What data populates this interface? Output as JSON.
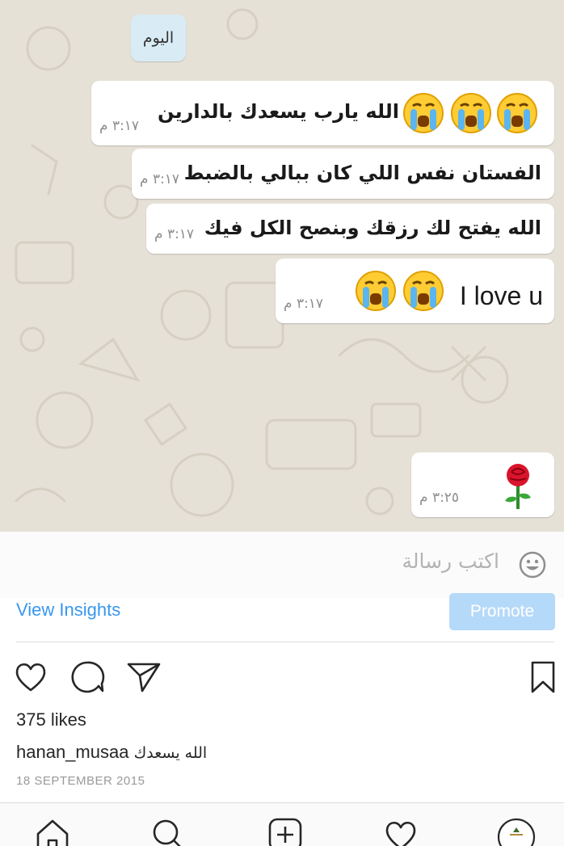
{
  "chat": {
    "date_chip": "اليوم",
    "messages": [
      {
        "text": "الله يارب يسعدك بالدارين",
        "time": "٣:١٧ م",
        "emojis": [
          "crying-face",
          "crying-face",
          "crying-face"
        ]
      },
      {
        "text": "الفستان نفس اللي كان ببالي بالضبط",
        "time": "٣:١٧ م",
        "emojis": []
      },
      {
        "text": "الله يفتح لك رزقك وبنصح الكل فيك",
        "time": "٣:١٧ م",
        "emojis": []
      },
      {
        "text": "I love u",
        "time": "٣:١٧ م",
        "emojis": [
          "crying-face",
          "crying-face"
        ]
      },
      {
        "text": "",
        "time": "٣:٢٥ م",
        "emojis": [
          "rose"
        ]
      }
    ],
    "composer_placeholder": "اكتب رسالة",
    "composer_icon": "smiley-icon",
    "colors": {
      "background": "#e6e1d7",
      "bubble": "#ffffff",
      "date_chip": "#d9ebf5"
    }
  },
  "post": {
    "view_insights": "View Insights",
    "promote": "Promote",
    "likes": "375 likes",
    "username": "hanan_musaa",
    "caption": "الله يسعدك",
    "date": "18 SEPTEMBER 2015",
    "actions": [
      "heart-icon",
      "comment-icon",
      "share-icon",
      "bookmark-icon"
    ],
    "colors": {
      "link": "#3897f0",
      "promote_bg": "#b5d9f9"
    }
  },
  "tabbar": {
    "items": [
      "home-icon",
      "search-icon",
      "add-post-icon",
      "activity-heart-icon",
      "profile-avatar"
    ]
  }
}
